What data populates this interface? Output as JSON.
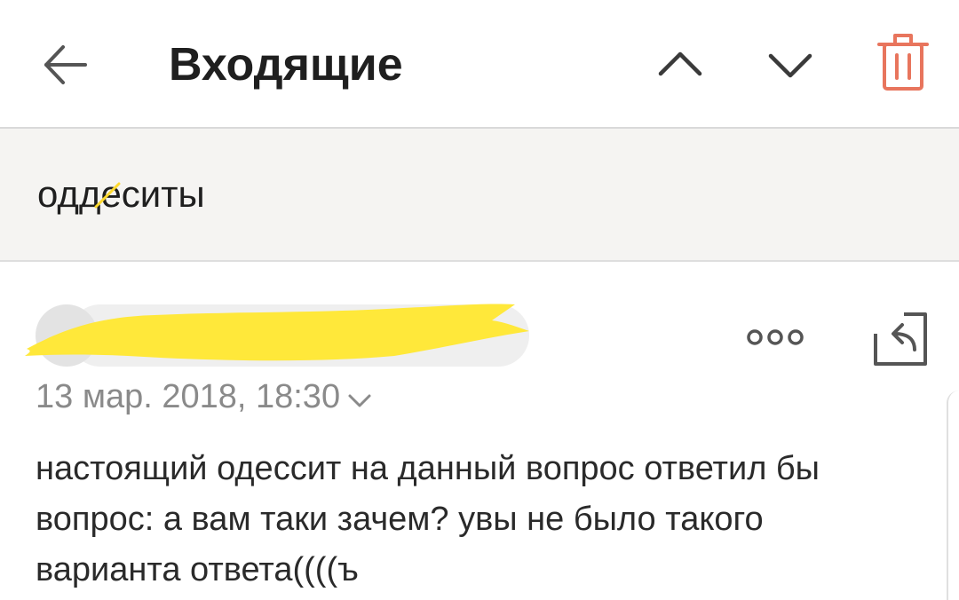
{
  "header": {
    "title": "Входящие",
    "back_icon": "arrow-left-icon",
    "prev_icon": "chevron-up-icon",
    "next_icon": "chevron-down-icon",
    "delete_icon": "trash-icon"
  },
  "message": {
    "subject": "оддеситы",
    "sender_redacted": true,
    "date": "13 мар. 2018, 18:30",
    "more_icon": "more-dots-icon",
    "reply_icon": "reply-icon",
    "body": "настоящий одессит на данный вопрос ответил бы\nвопрос: а вам таки зачем? увы не было такого\nварианта ответа((((ъ"
  },
  "colors": {
    "accent": "#e8755d",
    "icon_gray": "#555555",
    "subject_bg": "#f5f4f2",
    "highlight": "#ffe83a",
    "date_text": "#8a8a8a"
  }
}
